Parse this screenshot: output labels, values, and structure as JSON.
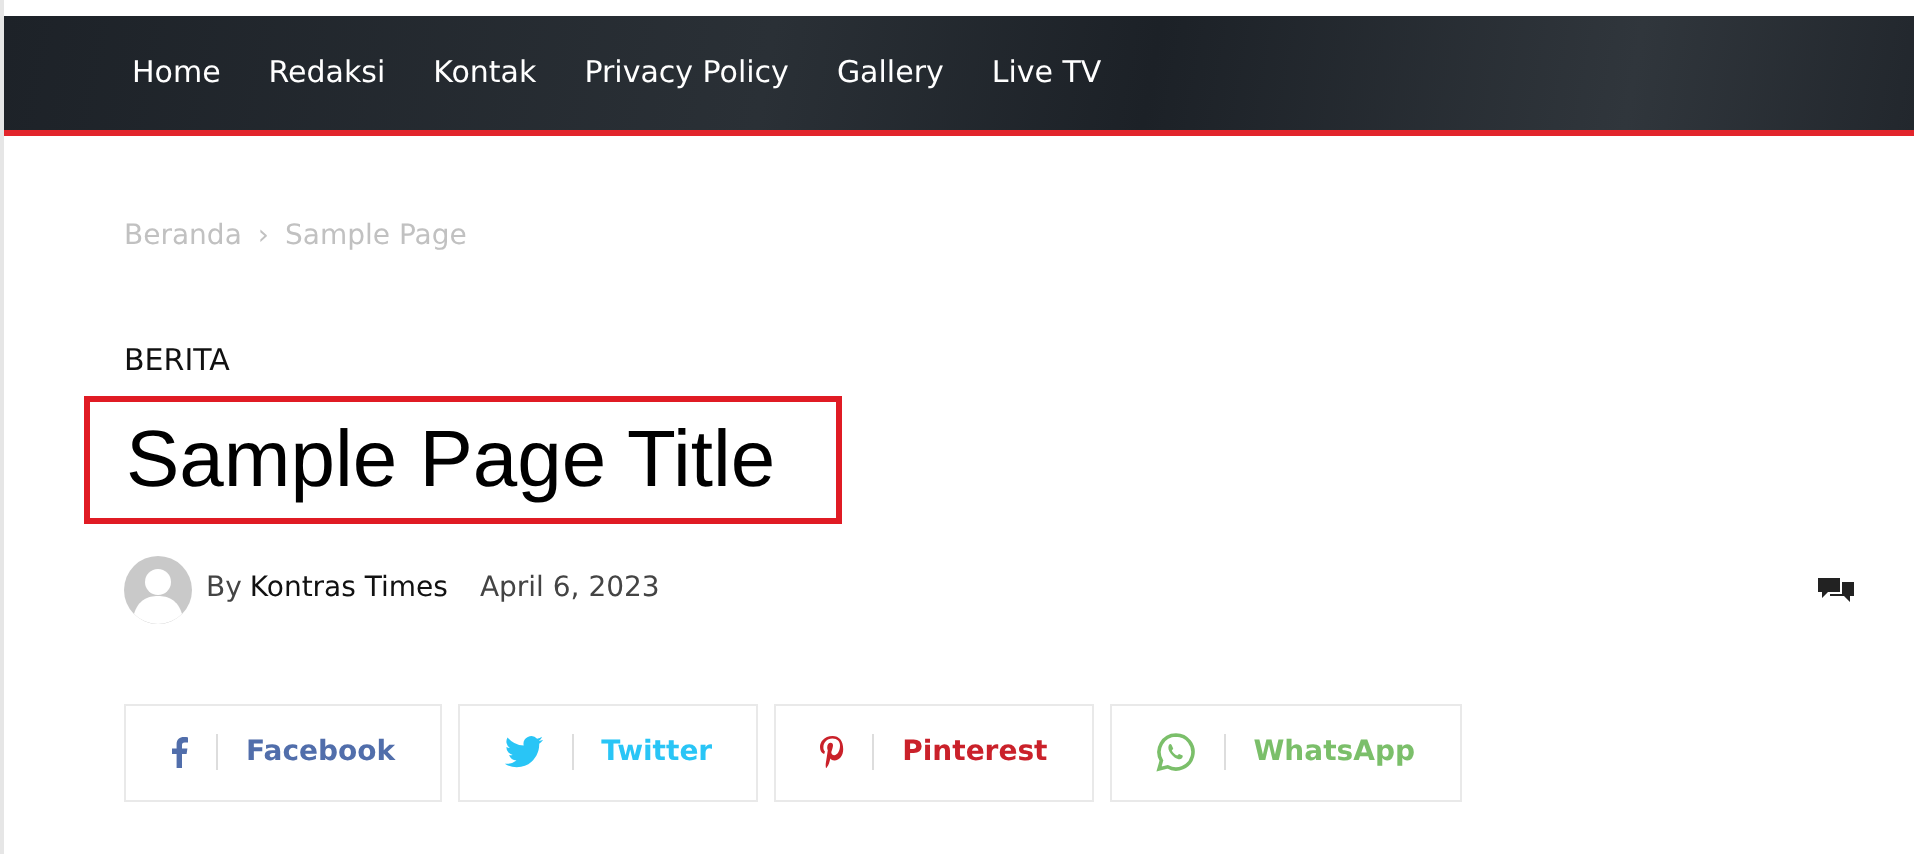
{
  "nav": {
    "items": [
      {
        "label": "Home"
      },
      {
        "label": "Redaksi"
      },
      {
        "label": "Kontak"
      },
      {
        "label": "Privacy Policy"
      },
      {
        "label": "Gallery"
      },
      {
        "label": "Live TV"
      }
    ]
  },
  "breadcrumb": {
    "items": [
      "Beranda",
      "Sample Page"
    ],
    "separator": "›"
  },
  "category": "BERITA",
  "title": {
    "text": "Sample Page Title",
    "highlighted": true
  },
  "meta": {
    "by": "By",
    "author": "Kontras Times",
    "date": "April 6, 2023"
  },
  "share": [
    {
      "kind": "facebook",
      "label": "Facebook",
      "color": "#516eab"
    },
    {
      "kind": "twitter",
      "label": "Twitter",
      "color": "#29c5f6"
    },
    {
      "kind": "pinterest",
      "label": "Pinterest",
      "color": "#ca212a"
    },
    {
      "kind": "whatsapp",
      "label": "WhatsApp",
      "color": "#7bbf6a"
    }
  ]
}
